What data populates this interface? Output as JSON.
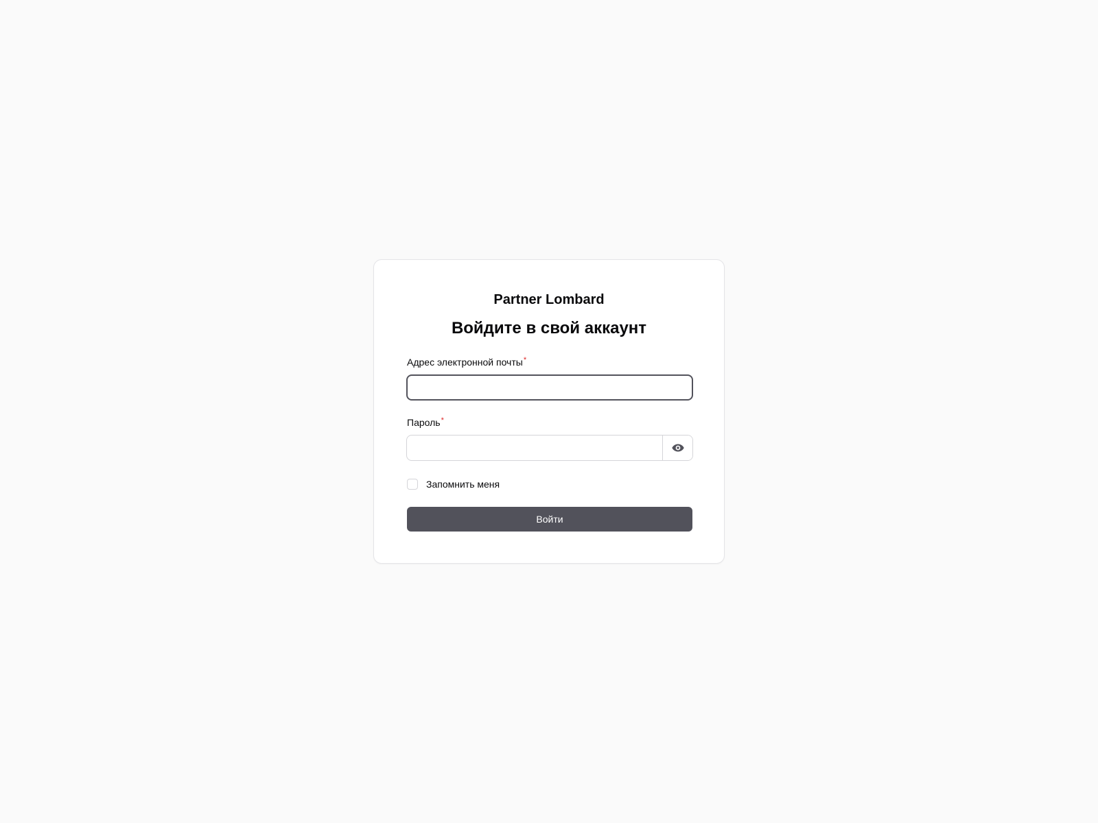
{
  "brand": {
    "name": "Partner Lombard"
  },
  "form": {
    "heading": "Войдите в свой аккаунт",
    "email": {
      "label": "Адрес электронной почты",
      "required_mark": "*",
      "value": ""
    },
    "password": {
      "label": "Пароль",
      "required_mark": "*",
      "value": "",
      "toggle_icon": "eye-icon"
    },
    "remember": {
      "label": "Запомнить меня",
      "checked": false
    },
    "submit_label": "Войти"
  },
  "colors": {
    "page_background": "#fafafa",
    "card_background": "#ffffff",
    "primary_button": "#52525b",
    "required": "#dc2626",
    "focus_border": "#52525b"
  }
}
